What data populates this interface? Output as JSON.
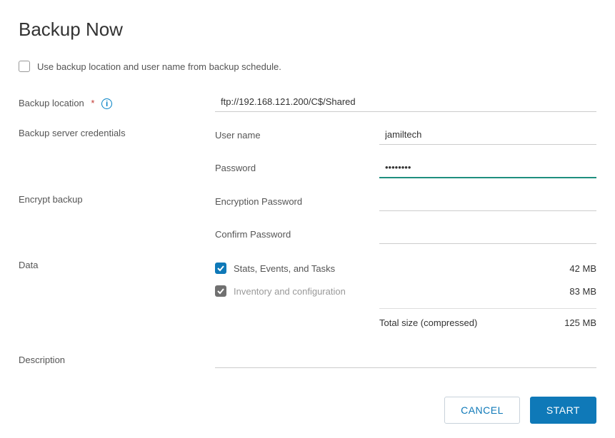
{
  "title": "Backup Now",
  "use_schedule": {
    "label": "Use backup location and user name from backup schedule.",
    "checked": false
  },
  "fields": {
    "backup_location_label": "Backup location",
    "backup_location_value": "ftp://192.168.121.200/C$/Shared",
    "server_creds_label": "Backup server credentials",
    "username_label": "User name",
    "username_value": "jamiltech",
    "password_label": "Password",
    "password_value": "********",
    "encrypt_label": "Encrypt backup",
    "enc_pw_label": "Encryption Password",
    "enc_pw_value": "",
    "confirm_pw_label": "Confirm Password",
    "confirm_pw_value": "",
    "data_label": "Data",
    "description_label": "Description",
    "description_value": ""
  },
  "data_items": [
    {
      "label": "Stats, Events, and Tasks",
      "size": "42 MB",
      "checked": true,
      "disabled": false
    },
    {
      "label": "Inventory and configuration",
      "size": "83 MB",
      "checked": true,
      "disabled": true
    }
  ],
  "total": {
    "label": "Total size (compressed)",
    "size": "125 MB"
  },
  "buttons": {
    "cancel": "CANCEL",
    "start": "START"
  }
}
